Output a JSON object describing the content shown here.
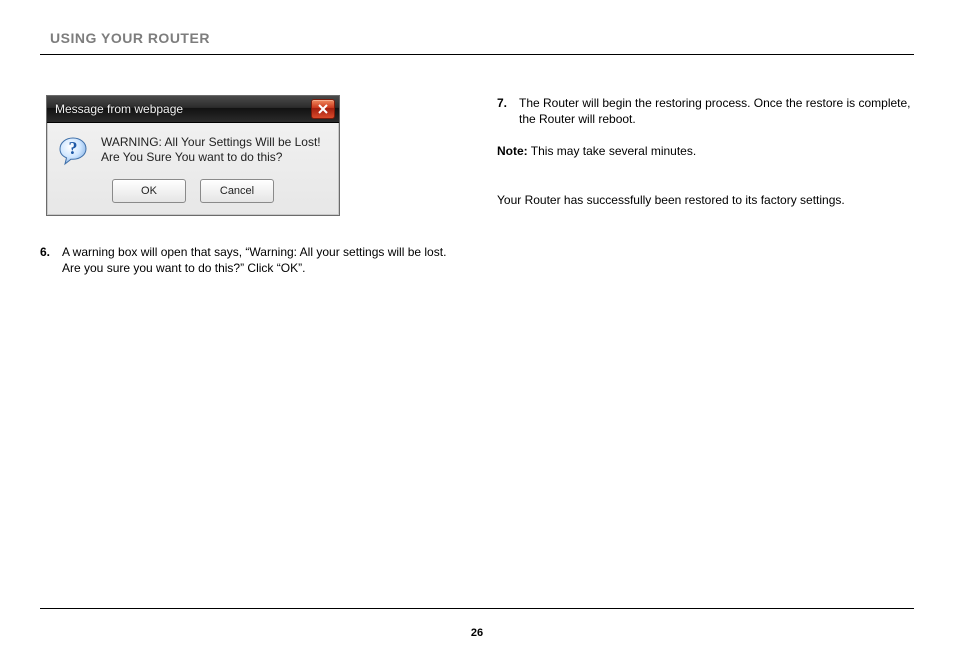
{
  "header": {
    "section_title": "USING YOUR ROUTER"
  },
  "dialog": {
    "title": "Message from webpage",
    "message_line1": "WARNING: All Your Settings Will be Lost!",
    "message_line2": "Are You Sure You want to do this?",
    "ok_label": "OK",
    "cancel_label": "Cancel"
  },
  "left": {
    "step6_num": "6.",
    "step6_text": "A warning box will open that says, “Warning: All your settings will be lost. Are you sure you want to do this?” Click “OK”."
  },
  "right": {
    "step7_num": "7.",
    "step7_text": "The Router will begin the restoring process. Once the restore is complete, the Router will reboot.",
    "note_label": "Note:",
    "note_text": " This may take several minutes.",
    "confirmation": "Your Router has successfully been restored to its factory settings."
  },
  "footer": {
    "page_number": "26"
  }
}
